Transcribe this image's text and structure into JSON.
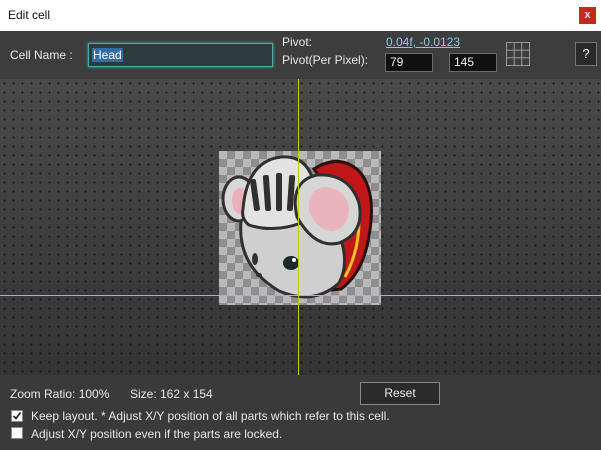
{
  "window": {
    "title": "Edit cell",
    "close_label": "x"
  },
  "header": {
    "cell_name_label": "Cell Name :",
    "cell_name_value": "Head",
    "pivot_label": "Pivot:",
    "pivot_value": "0.04f, -0.0123",
    "pivot_px_label": "Pivot(Per Pixel):",
    "pivot_px_x": "79",
    "pivot_px_y": "145",
    "help_label": "?"
  },
  "footer": {
    "zoom_text": "Zoom Ratio: 100%",
    "size_text": "Size: 162 x 154",
    "reset_label": "Reset",
    "keep_layout_label": "Keep layout. * Adjust X/Y position of all parts which refer to this cell.",
    "keep_layout_checked": true,
    "adjust_locked_label": "Adjust X/Y position even if the parts are locked.",
    "adjust_locked_checked": false
  },
  "icons": {
    "grid": "grid-icon",
    "check": "check-icon",
    "sprite": "knight-mouse-head-sprite"
  },
  "colors": {
    "guide": "#c8c800",
    "accent": "#4fa8a8",
    "link": "#8fc6e8",
    "close": "#c42b1c"
  }
}
